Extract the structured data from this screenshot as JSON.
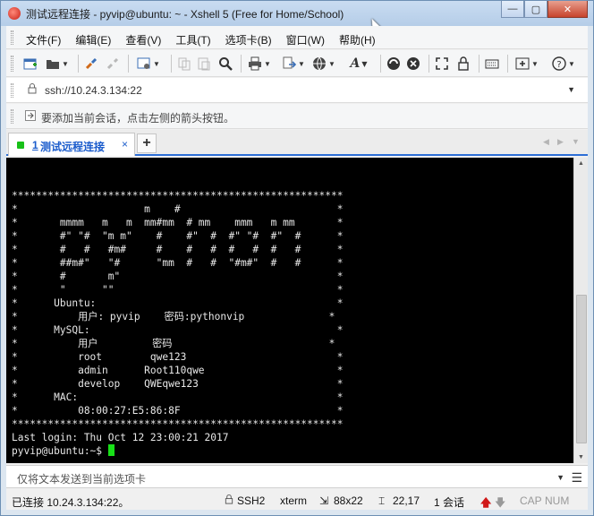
{
  "window": {
    "title": "测试远程连接 - pyvip@ubuntu: ~ - Xshell 5 (Free for Home/School)",
    "minimize": "—",
    "maximize": "▢",
    "close": "✕"
  },
  "menu": [
    "文件(F)",
    "编辑(E)",
    "查看(V)",
    "工具(T)",
    "选项卡(B)",
    "窗口(W)",
    "帮助(H)"
  ],
  "toolbar": {
    "icons": [
      "new-session-icon",
      "open-folder-icon",
      "reconnect-icon",
      "disconnect-icon",
      "properties-icon",
      "copy-icon",
      "paste-icon",
      "find-icon",
      "print-icon",
      "transfer-icon",
      "globe-icon",
      "font-icon",
      "xftp-icon",
      "xmanager-icon",
      "fullscreen-icon",
      "lock-icon",
      "keyboard-icon",
      "add-tab-icon",
      "help-icon"
    ]
  },
  "address": {
    "value": "ssh://10.24.3.134:22"
  },
  "hint": {
    "text": "要添加当前会话，点击左侧的箭头按钮。"
  },
  "tabs": [
    {
      "number": "1",
      "label": "测试远程连接",
      "active": true,
      "color": "#18c018"
    }
  ],
  "terminal": {
    "lines": [
      "*******************************************************",
      "*                     m    #                          *",
      "*       mmmm   m   m  mm#mm  # mm    mmm   m mm       *",
      "*       #\" \"#  \"m m\"    #    #\"  #  #\" \"#  #\"  #      *",
      "*       #   #   #m#     #    #   #  #   #  #   #      *",
      "*       ##m#\"   \"#      \"mm  #   #  \"#m#\"  #   #      *",
      "*       #       m\"                                    *",
      "*       \"      \"\"                                     *",
      "*      Ubuntu:                                        *",
      "*          用户: pyvip    密码:pythonvip              *",
      "*      MySQL:                                         *",
      "*          用户         密码                          *",
      "*          root        qwe123                         *",
      "*          admin      Root110qwe                      *",
      "*          develop    QWEqwe123                       *",
      "*      MAC:                                           *",
      "*          08:00:27:E5:86:8F                          *",
      "*******************************************************",
      "Last login: Thu Oct 12 23:00:21 2017",
      "pyvip@ubuntu:~$ "
    ],
    "cursor_color": "#18e018"
  },
  "sendbar": {
    "placeholder": "仅将文本发送到当前选项卡"
  },
  "status": {
    "connection": "已连接 10.24.3.134:22。",
    "protocol": "SSH2",
    "term": "xterm",
    "size": "88x22",
    "position": "22,17",
    "sessions": "1 会话",
    "cap": "CAP",
    "num": "NUM"
  }
}
